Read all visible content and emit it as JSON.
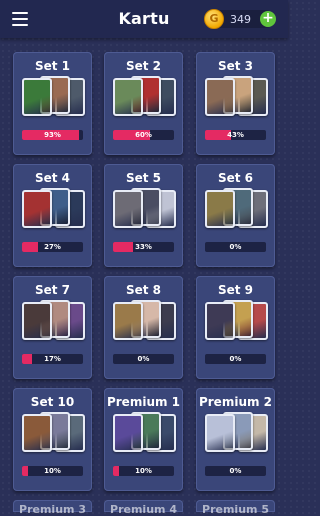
{
  "header": {
    "title": "Kartu",
    "coin_symbol": "G",
    "coins": "349",
    "plus": "+"
  },
  "sets": [
    {
      "name": "Set 1",
      "progress": "93%",
      "fill": 0.93,
      "colors": [
        "#3b7a3a",
        "#9a6a52",
        "#4e5a6a"
      ]
    },
    {
      "name": "Set 2",
      "progress": "60%",
      "fill": 0.6,
      "colors": [
        "#6a8a5a",
        "#b03030",
        "#3e4c60"
      ]
    },
    {
      "name": "Set 3",
      "progress": "43%",
      "fill": 0.43,
      "colors": [
        "#8a6a55",
        "#c9a37d",
        "#5b5a52"
      ]
    },
    {
      "name": "Set 4",
      "progress": "27%",
      "fill": 0.27,
      "colors": [
        "#a43232",
        "#3e5e8a",
        "#2b3a5a"
      ]
    },
    {
      "name": "Set 5",
      "progress": "33%",
      "fill": 0.33,
      "colors": [
        "#6d6b75",
        "#4a4d63",
        "#bfc3d4"
      ]
    },
    {
      "name": "Set 6",
      "progress": "0%",
      "fill": 0.0,
      "colors": [
        "#8a7a48",
        "#4f6a7a",
        "#6e6f7a"
      ]
    },
    {
      "name": "Set 7",
      "progress": "17%",
      "fill": 0.17,
      "colors": [
        "#4a3a3a",
        "#b08a80",
        "#6a4a8a"
      ]
    },
    {
      "name": "Set 8",
      "progress": "0%",
      "fill": 0.0,
      "colors": [
        "#9a7a4a",
        "#d6b8a8",
        "#3c3c4e"
      ]
    },
    {
      "name": "Set 9",
      "progress": "0%",
      "fill": 0.0,
      "colors": [
        "#3e3a55",
        "#c4a050",
        "#b64a4a"
      ]
    },
    {
      "name": "Set 10",
      "progress": "10%",
      "fill": 0.1,
      "colors": [
        "#8a5a3a",
        "#7a7a9a",
        "#5a6a7a"
      ]
    },
    {
      "name": "Premium 1",
      "progress": "10%",
      "fill": 0.1,
      "colors": [
        "#5a4a9a",
        "#4a7a5a",
        "#3a4a6a"
      ]
    },
    {
      "name": "Premium 2",
      "progress": "0%",
      "fill": 0.0,
      "colors": [
        "#b8c0d8",
        "#8a9ab8",
        "#c4b8a8"
      ]
    }
  ],
  "partial_titles": [
    "Premium 3",
    "Premium 4",
    "Premium 5"
  ]
}
